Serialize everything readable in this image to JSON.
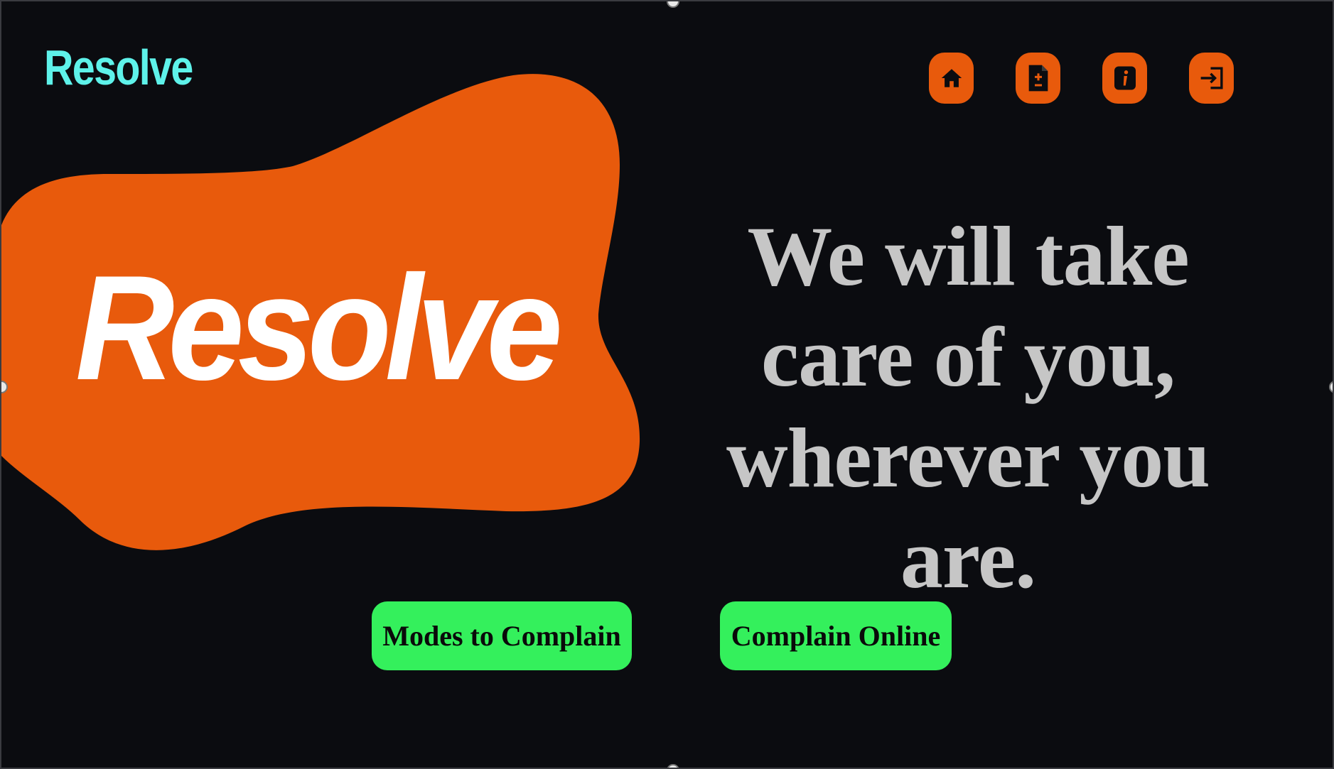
{
  "header": {
    "logo": "Resolve",
    "nav": [
      {
        "icon": "home-icon"
      },
      {
        "icon": "file-add-icon"
      },
      {
        "icon": "info-icon"
      },
      {
        "icon": "login-icon"
      }
    ]
  },
  "hero": {
    "brand": "Resolve",
    "tagline": "We will take care of you, wherever you are."
  },
  "actions": {
    "modes_label": "Modes to Complain",
    "online_label": "Complain Online"
  },
  "colors": {
    "background": "#0b0c10",
    "accent_orange": "#e85a0c",
    "logo_cyan": "#5ef2ea",
    "button_green": "#34f05c",
    "tagline_gray": "#c6c6c6"
  }
}
